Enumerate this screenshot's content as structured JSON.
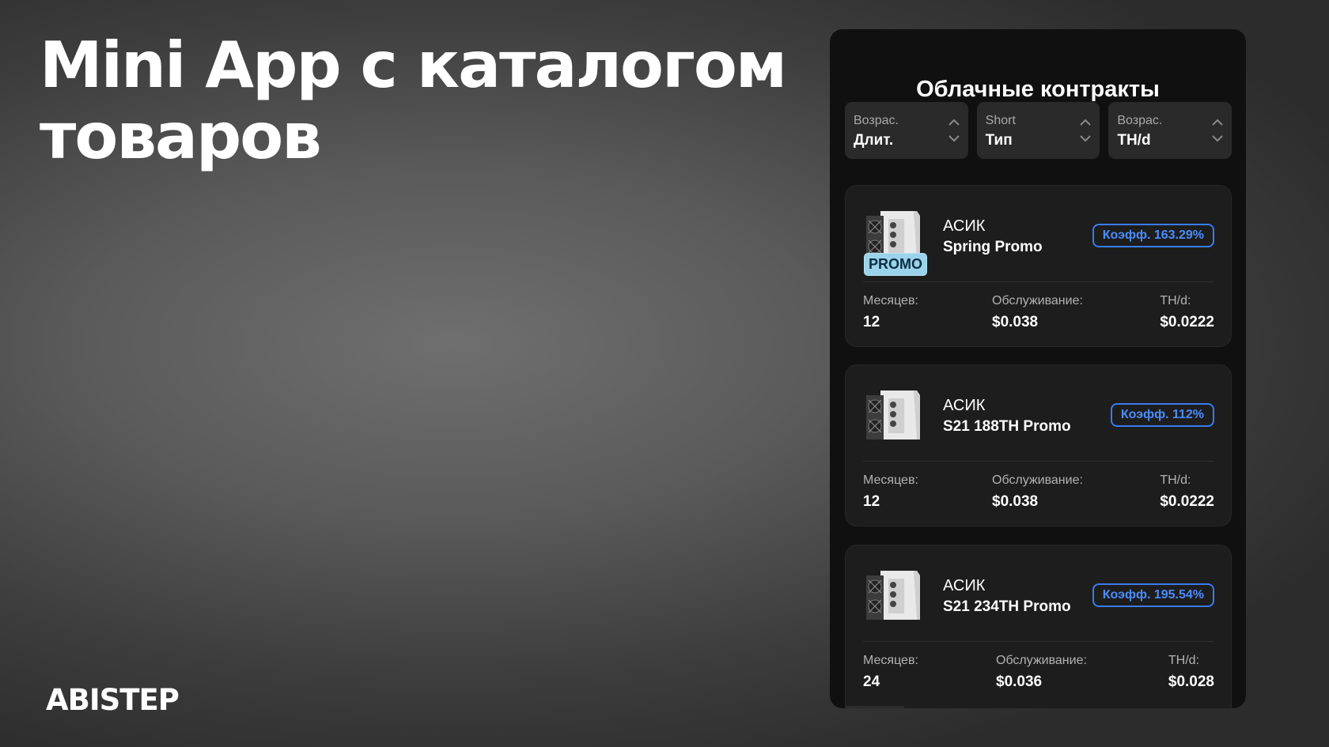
{
  "slide": {
    "headline_line1": "Mini App с каталогом",
    "headline_line2": "товаров",
    "brand": "ABISTEP"
  },
  "app": {
    "title": "Облачные контракты",
    "filters": [
      {
        "top": "Возрас.",
        "main": "Длит.",
        "icon": "sort-updown-icon"
      },
      {
        "top": "Short",
        "main": "Тип",
        "icon": "sort-updown-icon"
      },
      {
        "top": "Возрас.",
        "main": "TH/d",
        "icon": "sort-updown-icon"
      }
    ],
    "labels": {
      "months": "Месяцев:",
      "service": "Обслуживание:",
      "thd": "TH/d:"
    },
    "contracts": [
      {
        "kind": "АСИК",
        "name": "Spring Promo",
        "badge": "PROMO",
        "coef": "Коэфф. 163.29%",
        "months": "12",
        "service": "$0.038",
        "thd": "$0.0222",
        "image": "asic-miner-icon"
      },
      {
        "kind": "АСИК",
        "name": "S21 188TH Promo",
        "coef": "Коэфф. 112%",
        "months": "12",
        "service": "$0.038",
        "thd": "$0.0222",
        "image": "asic-miner-icon"
      },
      {
        "kind": "АСИК",
        "name": "S21 234TH Promo",
        "coef": "Коэфф. 195.54%",
        "months": "24",
        "service": "$0.036",
        "thd": "$0.028",
        "image": "asic-miner-icon"
      }
    ],
    "colors": {
      "accent": "#3a7bf0",
      "promo_badge": "#9bd3ea",
      "panel": "#101010",
      "card": "#1d1d1d",
      "filter": "#2a2a2a"
    }
  }
}
